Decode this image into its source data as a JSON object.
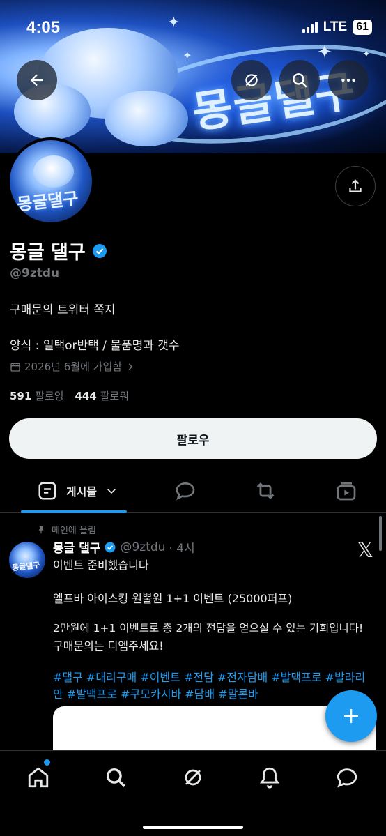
{
  "status_bar": {
    "time": "4:05",
    "network": "LTE",
    "battery": "61"
  },
  "banner": {
    "logo_text": "몽글댈구"
  },
  "profile": {
    "avatar_text": "몽글댈구",
    "name": "몽글 댈구",
    "handle": "@9ztdu",
    "bio_line1": "구매문의 트위터 쪽지",
    "bio_line2": "양식 : 일택or반택 / 물품명과 갯수",
    "joined": "2026년 6월에 가입함",
    "following_count": "591",
    "following_label": "팔로잉",
    "followers_count": "444",
    "followers_label": "팔로워",
    "follow_button": "팔로우"
  },
  "tabs": {
    "posts_label": "게시물"
  },
  "pinned_tweet": {
    "pinned_label": "메인에 올림",
    "avatar_text": "몽글댈구",
    "name": "몽글 댈구",
    "handle": "@9ztdu",
    "time": "· 4시",
    "line1": "이벤트 준비했습니다",
    "line2": "엘프바 아이스킹 원뿔원 1+1 이벤트 (25000퍼프)",
    "line3": "2만원에 1+1 이벤트로 총 2개의 전담을 얻으실 수 있는 기회입니다!",
    "line4": "구매문의는 디엠주세요!",
    "hashtags1": "#댈구 #대리구매 #이벤트 #전담 #전자담배 #발맥프로 #발라리",
    "hashtags2": "안 #발맥프로 #쿠모카시바 #담배 #말론바"
  },
  "colors": {
    "accent": "#1d9bf0",
    "background": "#000000",
    "muted": "#71767b"
  },
  "icons": [
    "back-arrow-icon",
    "grok-icon",
    "search-icon",
    "more-icon",
    "share-icon",
    "verified-icon",
    "calendar-icon",
    "chevron-right-icon",
    "posts-icon",
    "chevron-down-icon",
    "reply-icon",
    "retweet-icon",
    "media-icon",
    "pin-icon",
    "x-logo-icon",
    "plus-icon",
    "home-icon",
    "notifications-icon",
    "messages-icon"
  ]
}
